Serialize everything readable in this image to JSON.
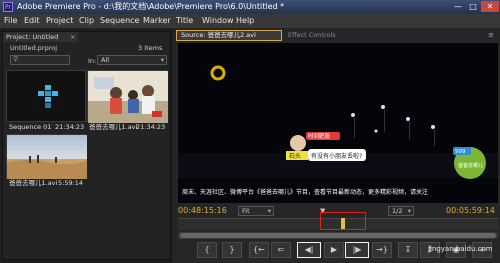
{
  "window": {
    "title": "Adobe Premiere Pro - d:\\我的文档\\Adobe\\Premiere Pro\\6.0\\Untitled *",
    "app_icon": "Pr"
  },
  "menu": [
    "File",
    "Edit",
    "Project",
    "Clip",
    "Sequence",
    "Marker",
    "Title",
    "Window",
    "Help"
  ],
  "project": {
    "tab": "Project: Untitled",
    "file": "Untitled.prproj",
    "item_count": "3 Items",
    "in_label": "In:",
    "in_value": "All",
    "items": [
      {
        "name": "Sequence 01",
        "duration": "21:34:23",
        "icon": "sequence-icon"
      },
      {
        "name": "爸爸去哪儿1.avi",
        "duration": "21:34:23",
        "icon": "video-thumbnail"
      },
      {
        "name": "爸爸去哪儿1.avi",
        "duration": "5:59:14",
        "icon": "video-thumbnail"
      }
    ]
  },
  "source": {
    "tab": "Source: 爸爸去哪儿2.avi",
    "effect_tab": "Effect Controls",
    "timecode": "00:48:15:16",
    "fit": "Fit",
    "ratio": "1/2",
    "duration": "00:05:59:14",
    "video": {
      "bubble_top": "时到肥股",
      "bubble_name": "石头",
      "bubble_text": "有没有小朋友丢啦?",
      "ticker": "周末、天涯社区、微博平台《爸爸去哪儿》节目，查看节目最新动态，更多精彩视频，请关注",
      "badge_num": "999",
      "badge_text": "爸爸去哪儿"
    },
    "controls": [
      "mark-in",
      "mark-out",
      "go-to-in",
      "step-back",
      "play",
      "step-forward",
      "go-to-out",
      "insert",
      "overwrite",
      "export-frame",
      "settings"
    ]
  },
  "watermark": "jingyan.baidu.com",
  "colors": {
    "accent": "#e3a834",
    "highlight": "#e0201d",
    "title_bar": "#2b3a57"
  }
}
